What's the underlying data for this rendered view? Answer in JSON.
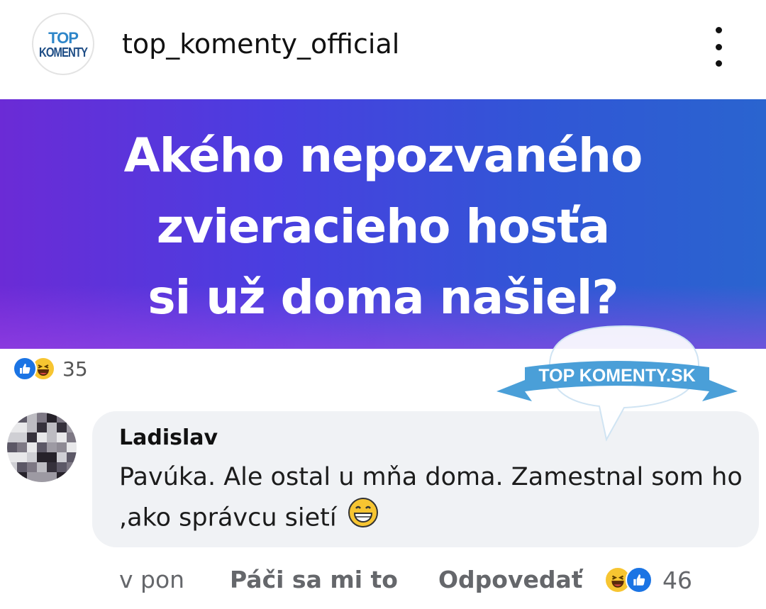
{
  "header": {
    "logo_line1": "TOP",
    "logo_line2": "KOMENTY",
    "username": "top_komenty_official",
    "more_icon": "more-vertical-icon"
  },
  "banner": {
    "lines": [
      "Akého nepozvaného",
      "zvieracieho hosťa",
      "si už doma našiel?"
    ],
    "gradient": [
      "#6b2bd6",
      "#2a64cf"
    ]
  },
  "post_reactions": {
    "icons": [
      "like-icon",
      "haha-icon"
    ],
    "count": "35"
  },
  "watermark": {
    "text": "TOP KOMENTY.SK",
    "color": "#4a9fd8"
  },
  "comment": {
    "author": "Ladislav",
    "text": "Pavúka. Ale ostal u mňa doma. Zamestnal som ho ,ako správcu sietí",
    "emoji": "grinning-face-icon"
  },
  "comment_actions": {
    "time": "v pon",
    "like_label": "Páči sa mi to",
    "reply_label": "Odpovedať",
    "reaction_icons": [
      "haha-icon",
      "like-icon"
    ],
    "reaction_count": "46"
  },
  "colors": {
    "like_blue": "#1b74e4",
    "haha_yellow": "#f7c531",
    "bubble_bg": "#f0f2f5",
    "muted_text": "#65676b"
  }
}
